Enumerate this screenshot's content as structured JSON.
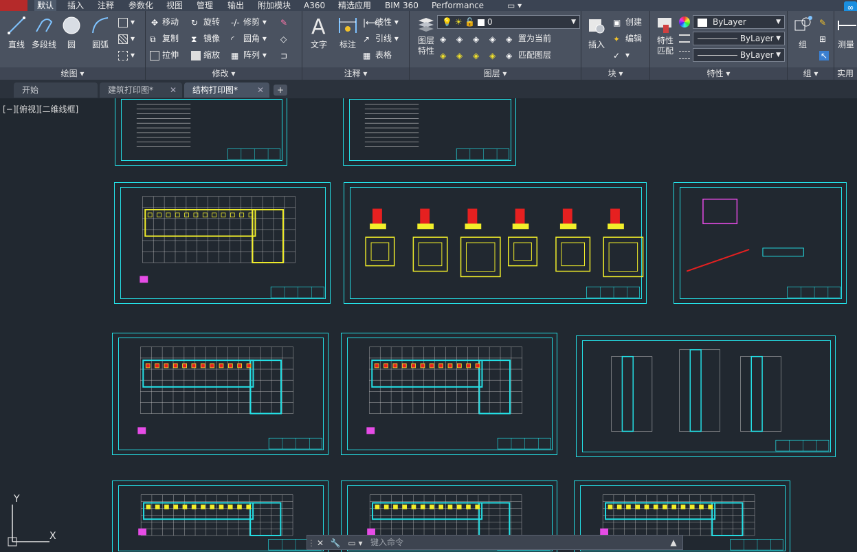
{
  "menu_tabs": [
    "默认",
    "插入",
    "注释",
    "参数化",
    "视图",
    "管理",
    "输出",
    "附加模块",
    "A360",
    "精选应用",
    "BIM 360",
    "Performance"
  ],
  "ribbon": {
    "draw": {
      "title": "绘图 ▾",
      "line": "直线",
      "polyline": "多段线",
      "circle": "圆",
      "arc": "圆弧"
    },
    "modify": {
      "title": "修改 ▾",
      "move": "移动",
      "rotate": "旋转",
      "trim": "修剪",
      "copy": "复制",
      "mirror": "镜像",
      "fillet": "圆角",
      "stretch": "拉伸",
      "scale": "缩放",
      "array": "阵列"
    },
    "annotation": {
      "title": "注释 ▾",
      "text": "文字",
      "dimension": "标注",
      "linear": "线性",
      "leader": "引线",
      "table": "表格"
    },
    "layers": {
      "title": "图层 ▾",
      "layer_props": "图层\n特性",
      "layer_value": "0",
      "set_current": "置为当前",
      "match_layer": "匹配图层"
    },
    "block": {
      "title": "块 ▾",
      "insert": "插入",
      "create": "创建",
      "edit": "编辑"
    },
    "properties": {
      "title": "特性 ▾",
      "match": "特性\n匹配",
      "color": "ByLayer",
      "linetype": "ByLayer",
      "lineweight": "ByLayer"
    },
    "groups": {
      "title": "组 ▾",
      "group": "组"
    },
    "utilities": {
      "title": "实用",
      "measure": "测量"
    }
  },
  "doc_tabs": [
    {
      "label": "开始",
      "active": false
    },
    {
      "label": "建筑打印图*",
      "active": false
    },
    {
      "label": "结构打印图*",
      "active": true
    }
  ],
  "viewport_label": "[−][俯视][二维线框]",
  "command_line": {
    "placeholder": "键入命令"
  },
  "colors": {
    "cyan": "#24e0e6",
    "yellow": "#f2ef2a",
    "red": "#e62020",
    "bg": "#212830"
  }
}
